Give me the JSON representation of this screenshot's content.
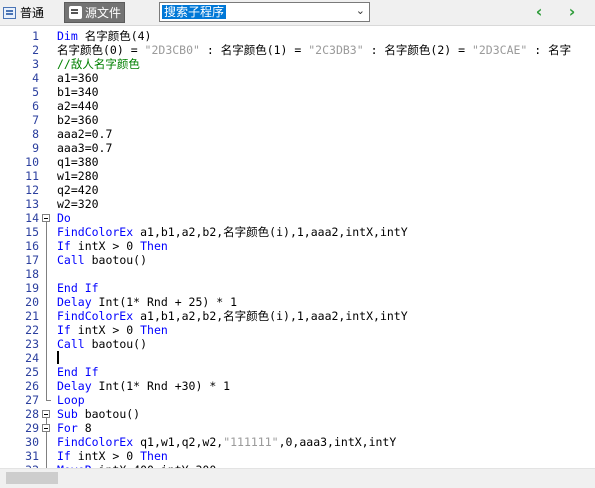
{
  "toolbar": {
    "normal_label": "普通",
    "source_label": "源文件",
    "combo_value": "搜索子程序",
    "icons": {
      "normal": "document-icon",
      "source": "source-file-icon",
      "back": "arrow-left-icon",
      "forward": "arrow-right-icon"
    },
    "nav_color": "#2e9c3a"
  },
  "editor": {
    "lines": [
      {
        "n": "1",
        "segments": [
          {
            "t": "Dim",
            "c": "kw"
          },
          {
            "t": " 名字颜色(4)",
            "c": ""
          }
        ]
      },
      {
        "n": "2",
        "segments": [
          {
            "t": "名字颜色(0) = ",
            "c": ""
          },
          {
            "t": "\"2D3CB0\"",
            "c": "str"
          },
          {
            "t": " : 名字颜色(1) = ",
            "c": ""
          },
          {
            "t": "\"2C3DB3\"",
            "c": "str"
          },
          {
            "t": " : 名字颜色(2) = ",
            "c": ""
          },
          {
            "t": "\"2D3CAE\"",
            "c": "str"
          },
          {
            "t": " : 名字",
            "c": ""
          }
        ]
      },
      {
        "n": "3",
        "segments": [
          {
            "t": "//敌人名字颜色",
            "c": "cmt"
          }
        ]
      },
      {
        "n": "4",
        "segments": [
          {
            "t": "a1=360",
            "c": ""
          }
        ]
      },
      {
        "n": "5",
        "segments": [
          {
            "t": "b1=340",
            "c": ""
          }
        ]
      },
      {
        "n": "6",
        "segments": [
          {
            "t": "a2=440",
            "c": ""
          }
        ]
      },
      {
        "n": "7",
        "segments": [
          {
            "t": "b2=360",
            "c": ""
          }
        ]
      },
      {
        "n": "8",
        "segments": [
          {
            "t": "aaa2=0.7",
            "c": ""
          }
        ]
      },
      {
        "n": "9",
        "segments": [
          {
            "t": "aaa3=0.7",
            "c": ""
          }
        ]
      },
      {
        "n": "10",
        "segments": [
          {
            "t": "q1=380",
            "c": ""
          }
        ]
      },
      {
        "n": "11",
        "segments": [
          {
            "t": "w1=280",
            "c": ""
          }
        ]
      },
      {
        "n": "12",
        "segments": [
          {
            "t": "q2=420",
            "c": ""
          }
        ]
      },
      {
        "n": "13",
        "segments": [
          {
            "t": "w2=320",
            "c": ""
          }
        ]
      },
      {
        "n": "14",
        "segments": [
          {
            "t": "Do",
            "c": "kw"
          }
        ]
      },
      {
        "n": "15",
        "segments": [
          {
            "t": "FindColorEx",
            "c": "kw"
          },
          {
            "t": " a1,b1,a2,b2,名字颜色(i),1,aaa2,intX,intY",
            "c": ""
          }
        ]
      },
      {
        "n": "16",
        "segments": [
          {
            "t": "If",
            "c": "kw"
          },
          {
            "t": " intX > 0 ",
            "c": ""
          },
          {
            "t": "Then",
            "c": "kw"
          }
        ]
      },
      {
        "n": "17",
        "segments": [
          {
            "t": "Call",
            "c": "kw"
          },
          {
            "t": " baotou()",
            "c": ""
          }
        ]
      },
      {
        "n": "18",
        "segments": []
      },
      {
        "n": "19",
        "segments": [
          {
            "t": "End If",
            "c": "kw"
          }
        ]
      },
      {
        "n": "20",
        "segments": [
          {
            "t": "Delay",
            "c": "kw"
          },
          {
            "t": " Int(1* Rnd + 25) * 1",
            "c": ""
          }
        ]
      },
      {
        "n": "21",
        "segments": [
          {
            "t": "FindColorEx",
            "c": "kw"
          },
          {
            "t": " a1,b1,a2,b2,名字颜色(i),1,aaa2,intX,intY",
            "c": ""
          }
        ]
      },
      {
        "n": "22",
        "segments": [
          {
            "t": "If",
            "c": "kw"
          },
          {
            "t": " intX > 0 ",
            "c": ""
          },
          {
            "t": "Then",
            "c": "kw"
          }
        ]
      },
      {
        "n": "23",
        "segments": [
          {
            "t": "Call",
            "c": "kw"
          },
          {
            "t": " baotou()",
            "c": ""
          }
        ]
      },
      {
        "n": "24",
        "segments": []
      },
      {
        "n": "25",
        "segments": [
          {
            "t": "End If",
            "c": "kw"
          }
        ]
      },
      {
        "n": "26",
        "segments": [
          {
            "t": "Delay",
            "c": "kw"
          },
          {
            "t": " Int(1* Rnd +30) * 1",
            "c": ""
          }
        ]
      },
      {
        "n": "27",
        "segments": [
          {
            "t": "Loop",
            "c": "kw"
          }
        ]
      },
      {
        "n": "28",
        "segments": [
          {
            "t": "Sub",
            "c": "kw"
          },
          {
            "t": " baotou()",
            "c": ""
          }
        ]
      },
      {
        "n": "29",
        "segments": [
          {
            "t": "For",
            "c": "kw"
          },
          {
            "t": " 8",
            "c": ""
          }
        ]
      },
      {
        "n": "30",
        "segments": [
          {
            "t": "FindColorEx",
            "c": "kw"
          },
          {
            "t": " q1,w1,q2,w2,",
            "c": ""
          },
          {
            "t": "\"111111\"",
            "c": "str"
          },
          {
            "t": ",0,aaa3,intX,intY",
            "c": ""
          }
        ]
      },
      {
        "n": "31",
        "segments": [
          {
            "t": "If",
            "c": "kw"
          },
          {
            "t": " intX > 0 ",
            "c": ""
          },
          {
            "t": "Then",
            "c": "kw"
          }
        ]
      },
      {
        "n": "32",
        "segments": [
          {
            "t": "MoveR",
            "c": "kw"
          },
          {
            "t": " intX-400,intY-300",
            "c": ""
          }
        ]
      }
    ]
  }
}
